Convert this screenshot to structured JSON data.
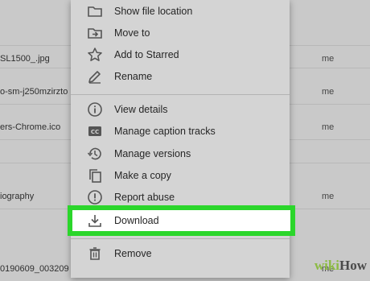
{
  "background_rows": [
    {
      "name": "",
      "owner": ""
    },
    {
      "name": "SL1500_.jpg",
      "owner": "me"
    },
    {
      "name": "o-sm-j250mzirzto",
      "owner": "me"
    },
    {
      "name": "ers-Chrome.ico",
      "owner": "me"
    },
    {
      "name": "",
      "owner": ""
    },
    {
      "name": "iography",
      "owner": "me"
    },
    {
      "name": "",
      "owner": ""
    },
    {
      "name": "0190609_003209",
      "owner": "me"
    }
  ],
  "menu": {
    "items": [
      {
        "label": "Show file location",
        "icon": "folder-icon"
      },
      {
        "label": "Move to",
        "icon": "move-to-icon"
      },
      {
        "label": "Add to Starred",
        "icon": "star-icon"
      },
      {
        "label": "Rename",
        "icon": "pencil-icon"
      },
      {
        "label": "View details",
        "icon": "info-icon"
      },
      {
        "label": "Manage caption tracks",
        "icon": "cc-icon"
      },
      {
        "label": "Manage versions",
        "icon": "history-icon"
      },
      {
        "label": "Make a copy",
        "icon": "copy-icon"
      },
      {
        "label": "Report abuse",
        "icon": "report-icon"
      },
      {
        "label": "Download",
        "icon": "download-icon"
      },
      {
        "label": "Remove",
        "icon": "trash-icon"
      }
    ]
  },
  "highlight_color": "#2bd62b",
  "watermark": {
    "wiki": "wiki",
    "how": "How"
  }
}
